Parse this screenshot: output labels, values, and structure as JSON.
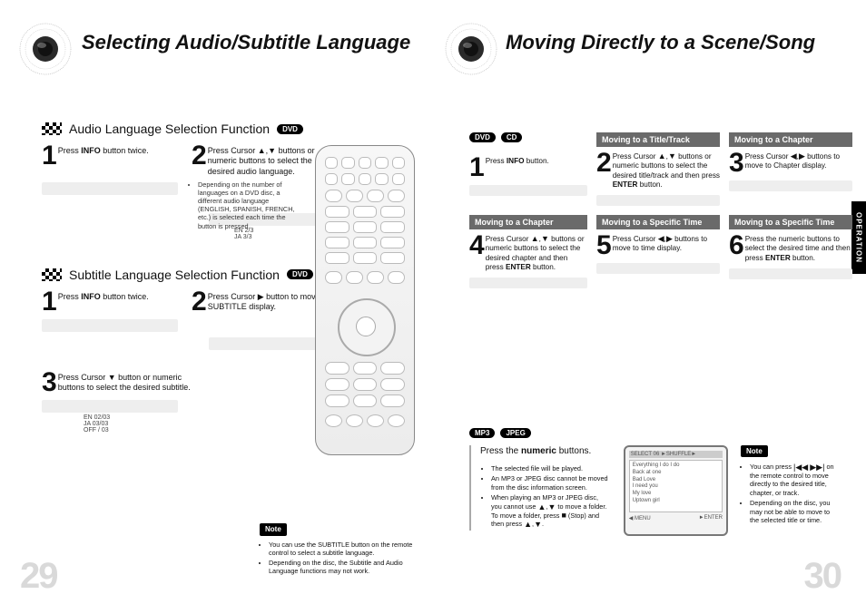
{
  "left": {
    "title": "Selecting Audio/Subtitle Language",
    "page_num": "29",
    "sections": {
      "audio": {
        "heading": "Audio Language Selection Function",
        "pill": "DVD",
        "step1": "Press <b>INFO</b> button twice.",
        "step2": "Press Cursor <span class='arrow'>▲</span>,<span class='arrow'>▼</span> buttons or numeric buttons to select the desired audio language.",
        "note": "Depending on the number of languages on a DVD disc, a different audio language (ENGLISH, SPANISH, FRENCH, etc.) is selected each time the button is pressed.",
        "menu1": "EN 2/3",
        "menu2": "JA 3/3"
      },
      "subtitle": {
        "heading": "Subtitle Language Selection Function",
        "pill": "DVD",
        "step1": "Press <b>INFO</b> button twice.",
        "step2": "Press Cursor <span class='arrow'>▶</span> button to move to SUBTITLE display.",
        "step3": "Press Cursor <span class='arrow'>▼</span> button or numeric buttons to select the desired subtitle.",
        "menu1": "EN 02/03",
        "menu2": "JA 03/03",
        "menu3": "OFF / 03"
      }
    },
    "bottom_note": {
      "label": "Note",
      "b1": "You can use the SUBTITLE button on the remote control to select a subtitle language.",
      "b2": "Depending on the disc, the Subtitle and Audio Language functions may not work."
    }
  },
  "right": {
    "title": "Moving Directly to a Scene/Song",
    "page_num": "30",
    "side_tab": "OPERATION",
    "pills": {
      "dvd": "DVD",
      "cd": "CD"
    },
    "cards": {
      "c1": {
        "text": "Press <b>INFO</b> button."
      },
      "c2": {
        "hd": "Moving to a Title/Track",
        "text": "Press Cursor <span class='arrow'>▲</span>,<span class='arrow'>▼</span> buttons or numeric buttons to select the desired title/track and then press <b>ENTER</b> button."
      },
      "c3": {
        "hd": "Moving to a Chapter",
        "text": "Press Cursor <span class='arrow'>◀</span>,<span class='arrow'>▶</span> buttons to move to Chapter display."
      },
      "c4": {
        "hd": "Moving to a Chapter",
        "text": "Press Cursor <span class='arrow'>▲</span>,<span class='arrow'>▼</span> buttons or numeric buttons to select the desired chapter and then press <b>ENTER</b> button."
      },
      "c5": {
        "hd": "Moving to a Specific Time",
        "text": "Press Cursor <span class='arrow'>◀</span>,<span class='arrow'>▶</span> buttons to move to time display."
      },
      "c6": {
        "hd": "Moving to a Specific Time",
        "text": "Press the numeric buttons to select the desired time and then press <b>ENTER</b> button."
      }
    },
    "mp3": {
      "pill1": "MP3",
      "pill2": "JPEG",
      "main": "Press the <b>numeric</b> buttons.",
      "b1": "The selected file will be played.",
      "b2": "An MP3 or JPEG disc cannot be moved from the disc information screen.",
      "b3": "When playing an MP3 or JPEG disc, you cannot use <span class='arrow'>▲</span>,<span class='arrow'>▼</span> to move a folder. To move a folder, press <span class='arrow'>■</span> (Stop) and then press <span class='arrow'>▲</span>,<span class='arrow'>▼</span>."
    },
    "screen": {
      "title": "SELECT   06         ►SHUFFLE►",
      "items": [
        "Everything I do I do",
        "Back at one",
        "Bad Love",
        "I need you",
        "My love",
        "Uptown girl"
      ],
      "foot_l": "◀ MENU",
      "foot_r": "►ENTER"
    },
    "note": {
      "label": "Note",
      "b1": "You can press <span class='arrow'>|◀◀</span> <span class='arrow'>▶▶|</span> on the remote control to move directly to the desired title, chapter, or track.",
      "b2": "Depending on the disc, you may not be able to move to the selected title or time."
    }
  }
}
